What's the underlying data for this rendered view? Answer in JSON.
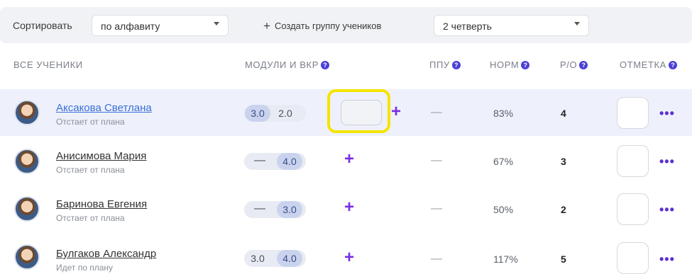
{
  "toolbar": {
    "sort_label": "Сортировать",
    "sort_value": "по алфавиту",
    "create_group_label": "Создать группу учеников",
    "quarter_value": "2 четверть"
  },
  "columns": {
    "all_students": "ВСЕ УЧЕНИКИ",
    "modules": "МОДУЛИ И ВКР",
    "ppu": "ППУ",
    "norm": "НОРМ",
    "ro": "Р/О",
    "mark": "ОТМЕТКА"
  },
  "students": [
    {
      "name": "Аксакова Светлана",
      "status": "Отстает от плана",
      "modules": [
        "3.0",
        "2.0"
      ],
      "ppu": "—",
      "norm": "83%",
      "ro": "4",
      "selected": true
    },
    {
      "name": "Анисимова Мария",
      "status": "Отстает от плана",
      "modules": [
        "—",
        "4.0"
      ],
      "ppu": "—",
      "norm": "67%",
      "ro": "3",
      "selected": false
    },
    {
      "name": "Баринова Евгения",
      "status": "Отстает от плана",
      "modules": [
        "—",
        "3.0"
      ],
      "ppu": "—",
      "norm": "50%",
      "ro": "2",
      "selected": false
    },
    {
      "name": "Булгаков Александр",
      "status": "Идет по плану",
      "modules": [
        "3.0",
        "4.0"
      ],
      "ppu": "—",
      "norm": "117%",
      "ro": "5",
      "selected": false
    }
  ],
  "icons": {
    "add": "+",
    "more": "•••",
    "help": "?"
  },
  "colors": {
    "accent": "#5b2fd6",
    "plus": "#7a2ee0",
    "highlight_row": "#eef1fb",
    "focus_outline": "#f5e400",
    "link": "#3b6fd8"
  }
}
